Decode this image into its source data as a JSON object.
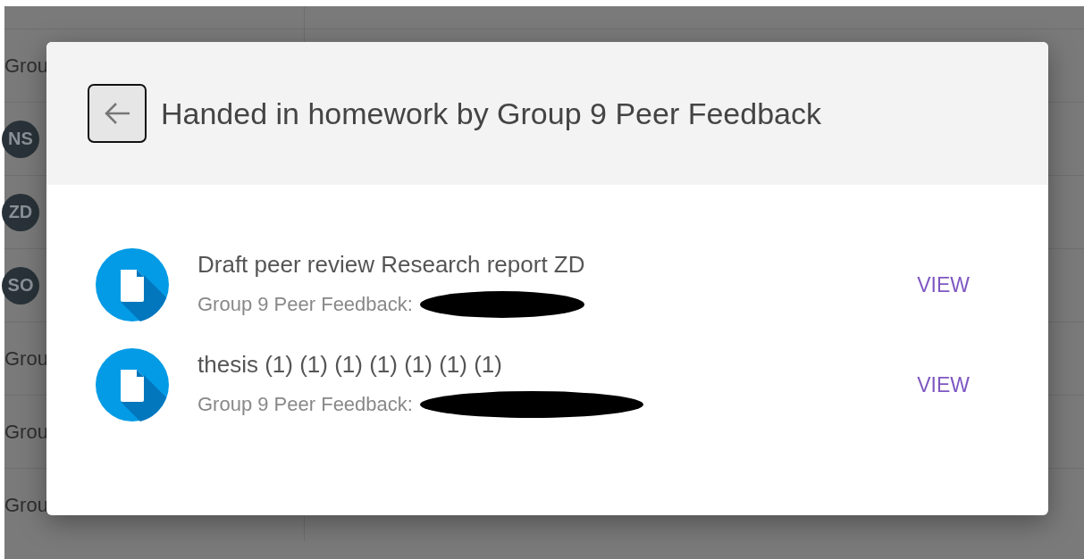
{
  "background_rows": [
    {
      "kind": "text",
      "label": "Grou"
    },
    {
      "kind": "avatar",
      "label": "NS"
    },
    {
      "kind": "avatar",
      "label": "ZD"
    },
    {
      "kind": "avatar",
      "label": "SO"
    },
    {
      "kind": "text",
      "label": "Grou"
    },
    {
      "kind": "text",
      "label": "Grou"
    },
    {
      "kind": "text",
      "label": "Grou"
    }
  ],
  "dialog": {
    "title": "Handed in homework by Group 9 Peer Feedback",
    "items": [
      {
        "title": "Draft peer review Research report ZD",
        "subtitle": "Group 9 Peer Feedback:",
        "action": "VIEW"
      },
      {
        "title": "thesis (1) (1) (1) (1) (1) (1) (1)",
        "subtitle": "Group 9 Peer Feedback:",
        "action": "VIEW"
      }
    ]
  }
}
